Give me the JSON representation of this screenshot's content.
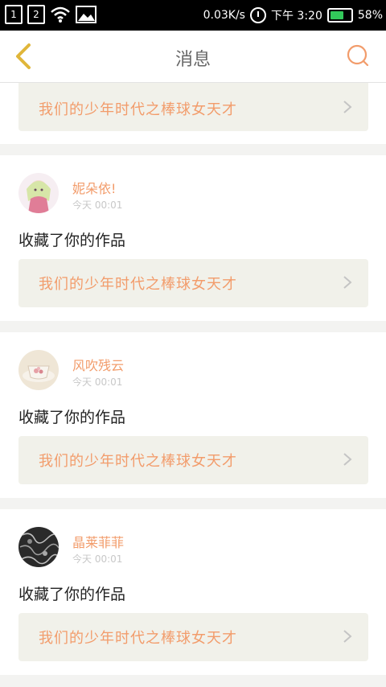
{
  "status_bar": {
    "sim1": "1",
    "sim2": "2",
    "net_speed": "0.03K/s",
    "time": "下午 3:20",
    "battery": "58%"
  },
  "header": {
    "title": "消息"
  },
  "feed": {
    "partial_card": {
      "work_title": "我们的少年时代之棒球女天才"
    },
    "items": [
      {
        "username": "妮朵依!",
        "time": "今天 00:01",
        "action": "收藏了你的作品",
        "work_title": "我们的少年时代之棒球女天才"
      },
      {
        "username": "风吹残云",
        "time": "今天 00:01",
        "action": "收藏了你的作品",
        "work_title": "我们的少年时代之棒球女天才"
      },
      {
        "username": "晶莱菲菲",
        "time": "今天 00:01",
        "action": "收藏了你的作品",
        "work_title": "我们的少年时代之棒球女天才"
      }
    ]
  },
  "colors": {
    "accent": "#f29c6b",
    "back_icon": "#e0b63a",
    "link_bg": "#f1f1ea"
  }
}
